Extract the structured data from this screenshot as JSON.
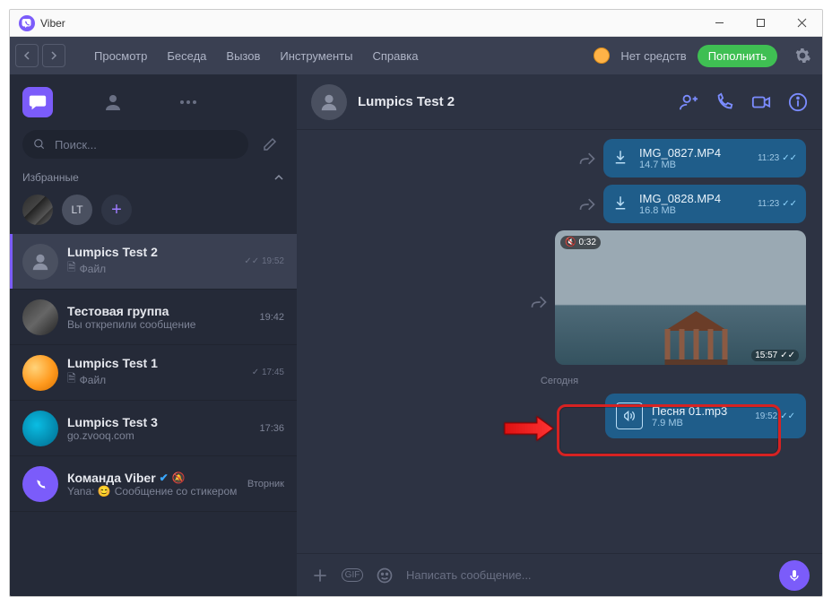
{
  "titlebar": {
    "app_name": "Viber"
  },
  "menu": {
    "items": [
      "Просмотр",
      "Беседа",
      "Вызов",
      "Инструменты",
      "Справка"
    ],
    "balance_text": "Нет средств",
    "topup": "Пополнить"
  },
  "sidebar": {
    "search_placeholder": "Поиск...",
    "favorites_label": "Избранные",
    "fav_initials": "LT",
    "chats": [
      {
        "name": "Lumpics Test 2",
        "sub": "Файл",
        "time": "19:52",
        "ticks": true,
        "icon": "file"
      },
      {
        "name": "Тестовая группа",
        "sub": "Вы открепили сообщение",
        "time": "19:42"
      },
      {
        "name": "Lumpics Test 1",
        "sub": "Файл",
        "time": "17:45",
        "ticks": true,
        "icon": "file"
      },
      {
        "name": "Lumpics Test 3",
        "sub": "go.zvooq.com",
        "time": "17:36"
      },
      {
        "name": "Команда Viber",
        "sub": "Сообщение со стикером",
        "time": "Вторник",
        "verified": true,
        "muted": true
      }
    ]
  },
  "chat": {
    "header_name": "Lumpics Test 2",
    "files": [
      {
        "name": "IMG_0827.MP4",
        "size": "14.7 MB",
        "time": "11:23"
      },
      {
        "name": "IMG_0828.MP4",
        "size": "16.8 MB",
        "time": "11:23"
      }
    ],
    "video": {
      "duration": "0:32",
      "time": "15:57"
    },
    "day_separator": "Сегодня",
    "audio": {
      "name": "Песня 01.mp3",
      "size": "7.9 MB",
      "time": "19:52"
    },
    "composer_placeholder": "Написать сообщение..."
  }
}
